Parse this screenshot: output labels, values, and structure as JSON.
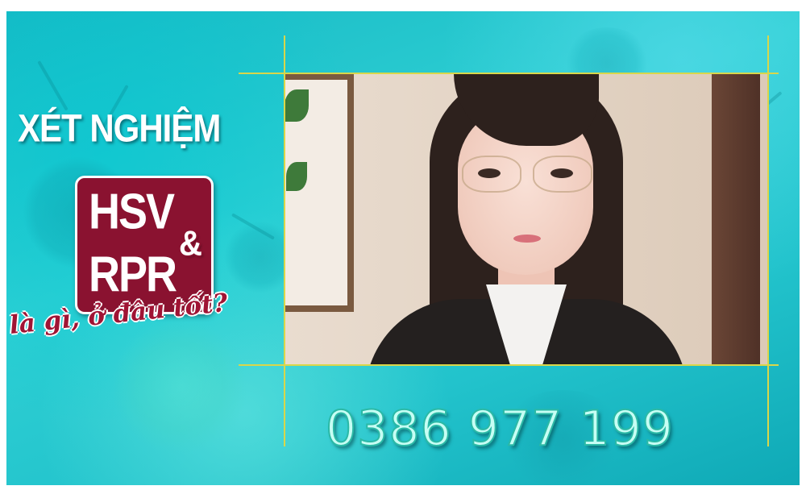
{
  "headline": "XÉT NGHIỆM",
  "badge": {
    "line1": "HSV",
    "line2": "RPR",
    "ampersand": "&",
    "color": "#8a1230"
  },
  "tagline": "là gì, ở đâu tốt?",
  "phone": "0386 977 199",
  "photo": {
    "subject": "woman-with-glasses-photo"
  },
  "colors": {
    "background": "#22c3cc",
    "guide_lines": "#d9d64a",
    "tagline": "#a01434",
    "phone_text": "#c6fff4"
  }
}
